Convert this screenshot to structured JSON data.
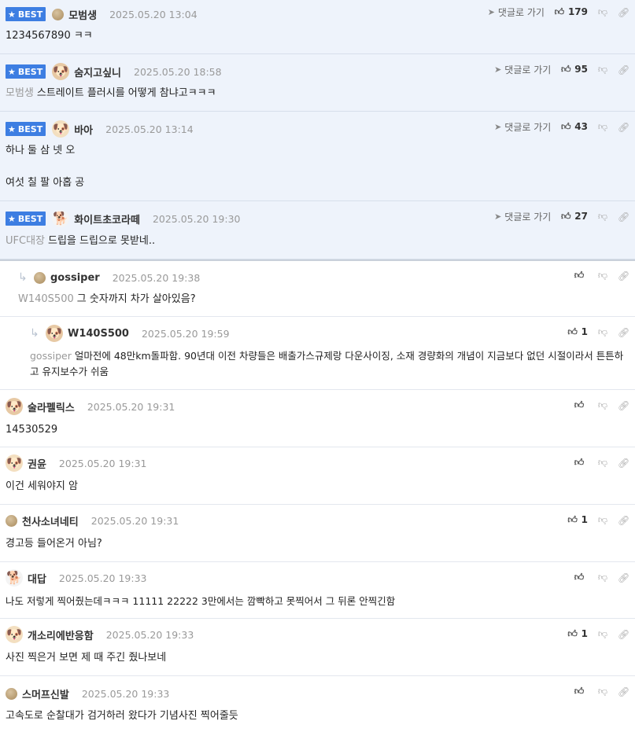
{
  "ui": {
    "best_label": "BEST",
    "goto_label": "댓글로 가기"
  },
  "comments": [
    {
      "best": true,
      "level": 0,
      "avatar": "ball",
      "nick": "모범생",
      "date": "2025.05.20 13:04",
      "target": "",
      "text": "1234567890 ㅋㅋ",
      "text2": "",
      "likes": "179",
      "goto": true
    },
    {
      "best": true,
      "level": 0,
      "avatar": "pup-red",
      "nick": "숨지고싶니",
      "date": "2025.05.20 18:58",
      "target": "모범생",
      "text": "스트레이트 플러시를 어떻게 참냐고ㅋㅋㅋ",
      "text2": "",
      "likes": "95",
      "goto": true
    },
    {
      "best": true,
      "level": 0,
      "avatar": "pup",
      "nick": "바아",
      "date": "2025.05.20 13:14",
      "target": "",
      "text": "하나 둘 삼 넷 오",
      "text2": "여섯 칠 팔 아홉 공",
      "likes": "43",
      "goto": true
    },
    {
      "best": true,
      "level": 0,
      "avatar": "white",
      "nick": "화이트초코라떼",
      "date": "2025.05.20 19:30",
      "target": "UFC대장",
      "text": "드립을 드립으로 못받네..",
      "text2": "",
      "likes": "27",
      "goto": true
    },
    {
      "best": false,
      "level": 1,
      "avatar": "ball",
      "nick": "gossiper",
      "date": "2025.05.20 19:38",
      "target": "W140S500",
      "text": "그 숫자까지 차가 살아있음?",
      "text2": "",
      "likes": "",
      "goto": false
    },
    {
      "best": false,
      "level": 2,
      "avatar": "pup-red",
      "nick": "W140S500",
      "date": "2025.05.20 19:59",
      "target": "gossiper",
      "text": "얼마전에 48만km돌파함. 90년대 이전 차량들은 배출가스규제랑 다운사이징, 소재 경량화의 개념이 지금보다 없던 시절이라서 튼튼하고 유지보수가 쉬움",
      "text2": "",
      "likes": "1",
      "goto": false
    },
    {
      "best": false,
      "level": 0,
      "avatar": "pup-red",
      "nick": "술라펠릭스",
      "date": "2025.05.20 19:31",
      "target": "",
      "text": "14530529",
      "text2": "",
      "likes": "",
      "goto": false
    },
    {
      "best": false,
      "level": 0,
      "avatar": "pup",
      "nick": "권윤",
      "date": "2025.05.20 19:31",
      "target": "",
      "text": "이건 세워야지 암",
      "text2": "",
      "likes": "",
      "goto": false
    },
    {
      "best": false,
      "level": 0,
      "avatar": "ball",
      "nick": "천사소녀네티",
      "date": "2025.05.20 19:31",
      "target": "",
      "text": "경고등 들어온거 아님?",
      "text2": "",
      "likes": "1",
      "goto": false
    },
    {
      "best": false,
      "level": 0,
      "avatar": "white",
      "nick": "대답",
      "date": "2025.05.20 19:33",
      "target": "",
      "text": "나도 저렇게 찍어줬는데ㅋㅋㅋ 11111 22222 3만에서는 깜빡하고 못찍어서 그 뒤론 안찍긴함",
      "text2": "",
      "likes": "",
      "goto": false
    },
    {
      "best": false,
      "level": 0,
      "avatar": "pup",
      "nick": "개소리에반응함",
      "date": "2025.05.20 19:33",
      "target": "",
      "text": "사진 찍은거 보면 제 때 주긴 줬나보네",
      "text2": "",
      "likes": "1",
      "goto": false
    },
    {
      "best": false,
      "level": 0,
      "avatar": "ball",
      "nick": "스머프신발",
      "date": "2025.05.20 19:33",
      "target": "",
      "text": "고속도로 순찰대가 검거하러 왔다가 기념사진 찍어줄듯",
      "text2": "",
      "likes": "",
      "goto": false
    }
  ]
}
